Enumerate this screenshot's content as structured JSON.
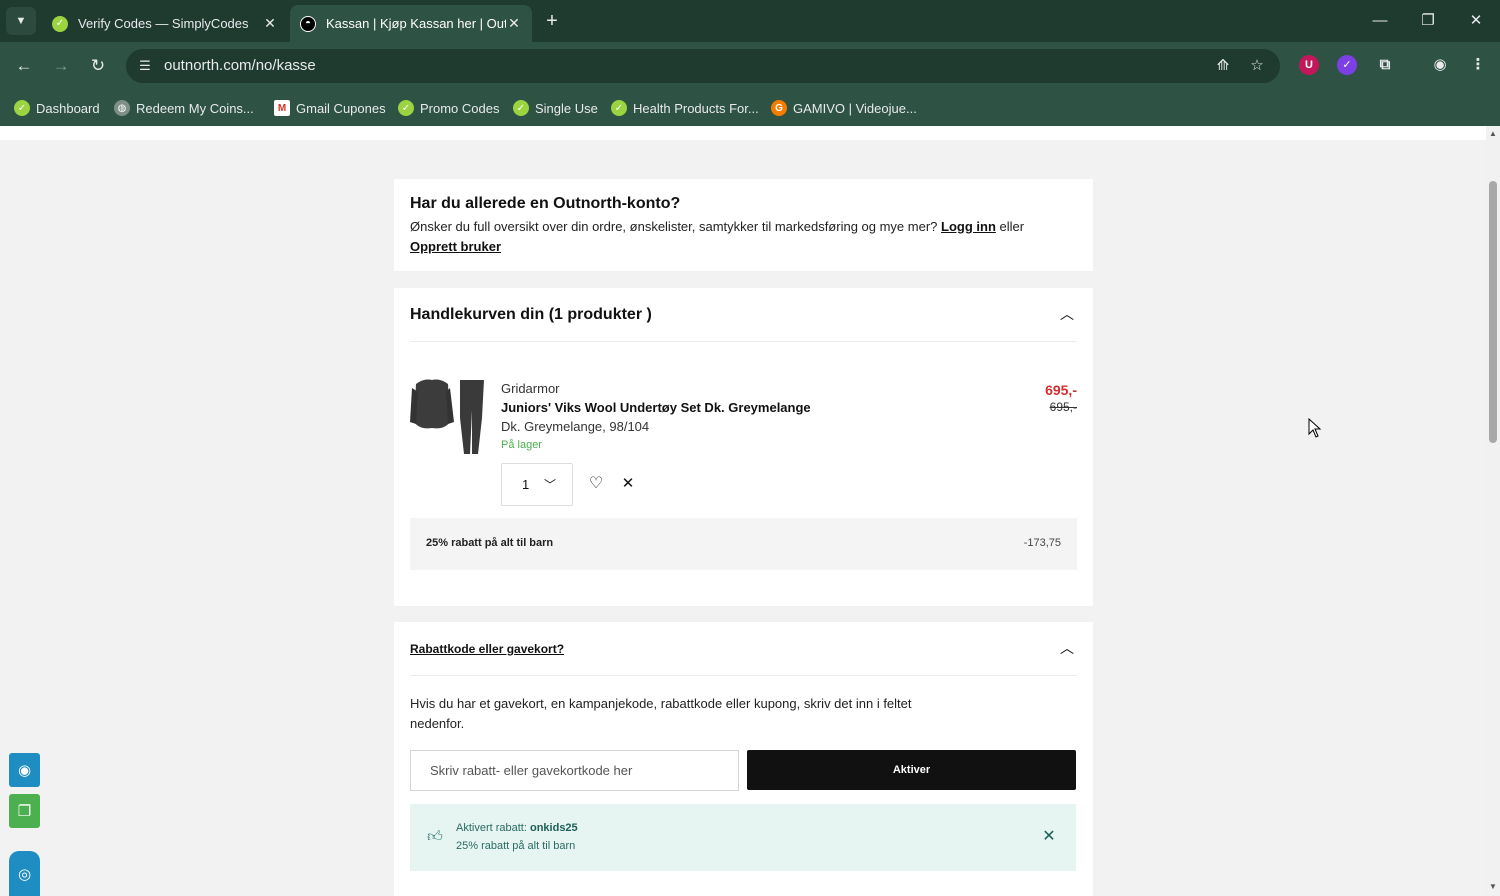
{
  "browser": {
    "tabs": [
      {
        "title": "Verify Codes — SimplyCodes",
        "active": false
      },
      {
        "title": "Kassan | Kjøp Kassan her | Outnorth",
        "active": true
      }
    ],
    "url": "outnorth.com/no/kasse",
    "bookmarks": [
      {
        "label": "Dashboard",
        "icon": "simplycodes-icon"
      },
      {
        "label": "Redeem My Coins...",
        "icon": "globe-icon"
      },
      {
        "label": "Gmail Cupones",
        "icon": "gmail-icon"
      },
      {
        "label": "Promo Codes",
        "icon": "simplycodes-icon"
      },
      {
        "label": "Single Use",
        "icon": "simplycodes-icon"
      },
      {
        "label": "Health Products For...",
        "icon": "simplycodes-icon"
      },
      {
        "label": "GAMIVO | Videojue...",
        "icon": "gamivo-icon"
      }
    ]
  },
  "account": {
    "heading": "Har du allerede en Outnorth-konto?",
    "text": "Ønsker du full oversikt over din ordre, ønskelister, samtykker til markedsføring og mye mer?",
    "login_link": "Logg inn",
    "or": "eller",
    "register_link": "Opprett bruker"
  },
  "cart": {
    "heading": "Handlekurven din (1 produkter )",
    "item": {
      "brand": "Gridarmor",
      "name": "Juniors' Viks Wool Undertøy Set Dk. Greymelange",
      "variant": "Dk. Greymelange, 98/104",
      "stock": "På lager",
      "price_new": "695,-",
      "price_old": "695,-",
      "quantity": "1"
    },
    "discount": {
      "label": "25% rabatt på alt til barn",
      "value": "-173,75"
    }
  },
  "promo": {
    "heading": "Rabattkode eller gavekort?",
    "info": "Hvis du har et gavekort, en kampanjekode, rabattkode eller kupong, skriv det inn i feltet nedenfor.",
    "placeholder": "Skriv rabatt- eller gavekortkode her",
    "button": "Aktiver",
    "applied_prefix": "Aktivert rabatt: ",
    "applied_code": "onkids25",
    "applied_desc": "25% rabatt på alt til barn"
  },
  "colors": {
    "chrome_dark": "#1f3a2f",
    "chrome": "#2e5244",
    "price_red": "#d32f2f",
    "stock_green": "#4caf50",
    "applied_bg": "#e6f4f2"
  }
}
